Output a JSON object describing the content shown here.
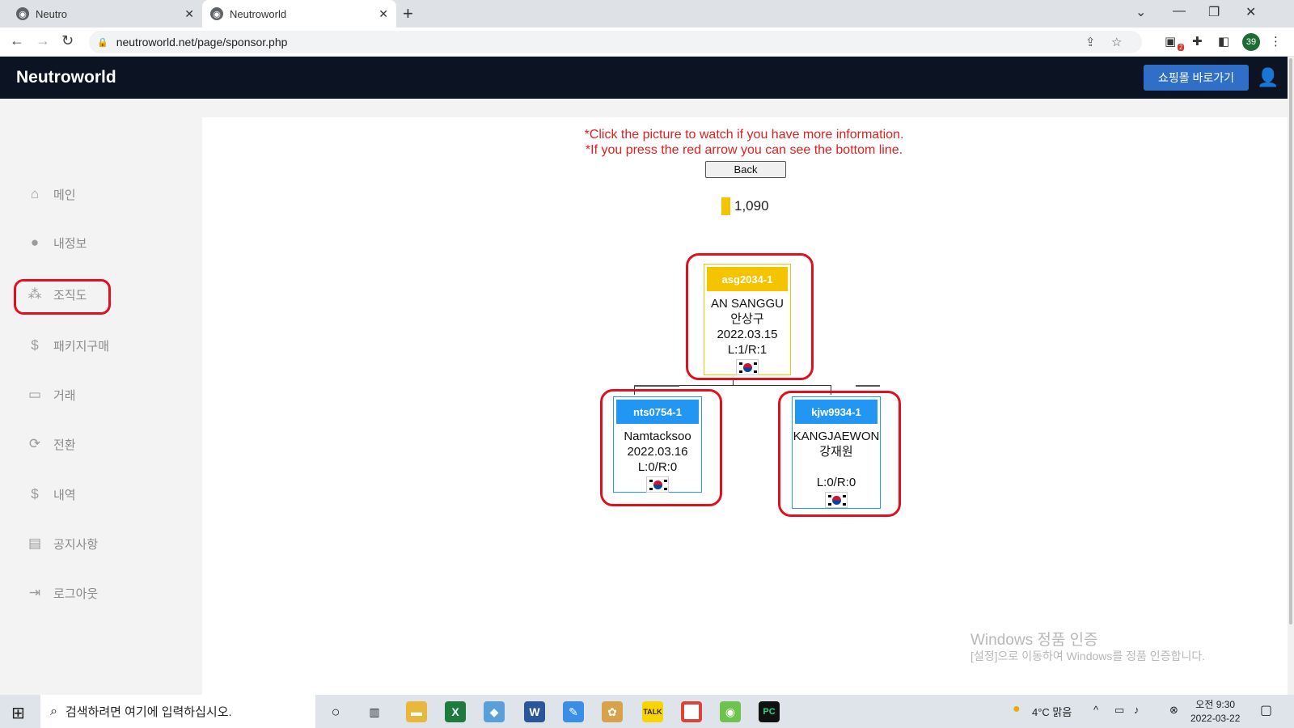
{
  "browser": {
    "tabs": [
      {
        "label": "Neutro",
        "close": "✕"
      },
      {
        "label": "Neutroworld",
        "close": "✕"
      }
    ],
    "new_tab": "+",
    "url": "neutroworld.net/page/sponsor.php",
    "extension_badge": "2",
    "profile_badge": "39"
  },
  "header": {
    "brand": "Neutroworld",
    "shop_button": "쇼핑몰 바로가기"
  },
  "sidebar": {
    "items": [
      {
        "label": "메인",
        "icon": "home-icon"
      },
      {
        "label": "내정보",
        "icon": "person-icon"
      },
      {
        "label": "조직도",
        "icon": "org-chart-icon"
      },
      {
        "label": "패키지구매",
        "icon": "money-bag-icon"
      },
      {
        "label": "거래",
        "icon": "wallet-icon"
      },
      {
        "label": "전환",
        "icon": "exchange-icon"
      },
      {
        "label": "내역",
        "icon": "money-bag-icon"
      },
      {
        "label": "공지사항",
        "icon": "chat-icon"
      },
      {
        "label": "로그아웃",
        "icon": "logout-icon"
      }
    ]
  },
  "main": {
    "notice_line1": "*Click the picture to watch if you have more information.",
    "notice_line2": "*If you press the red arrow you can see the bottom line.",
    "back_label": "Back",
    "points": "1,090",
    "tree": {
      "root": {
        "id": "asg2034-1",
        "name_en": "AN SANGGU",
        "name_kr": "안상구",
        "date": "2022.03.15",
        "lr": "L:1/R:1"
      },
      "left": {
        "id": "nts0754-1",
        "name_en": "Namtacksoo",
        "date": "2022.03.16",
        "lr": "L:0/R:0"
      },
      "right": {
        "id": "kjw9934-1",
        "name_en": "KANGJAEWON",
        "name_kr": "강재원",
        "lr": "L:0/R:0"
      }
    },
    "colors": {
      "root": "#f5c400",
      "child": "#2196f3",
      "highlight": "#e0101e",
      "notice": "#e02020"
    }
  },
  "watermark": {
    "line1": "Windows 정품 인증",
    "line2": "[설정]으로 이동하여 Windows를 정품 인증합니다."
  },
  "taskbar": {
    "search_placeholder": "검색하려면 여기에 입력하십시오.",
    "weather": "4°C 맑음",
    "time": "오전 9:30",
    "date": "2022-03-22"
  }
}
